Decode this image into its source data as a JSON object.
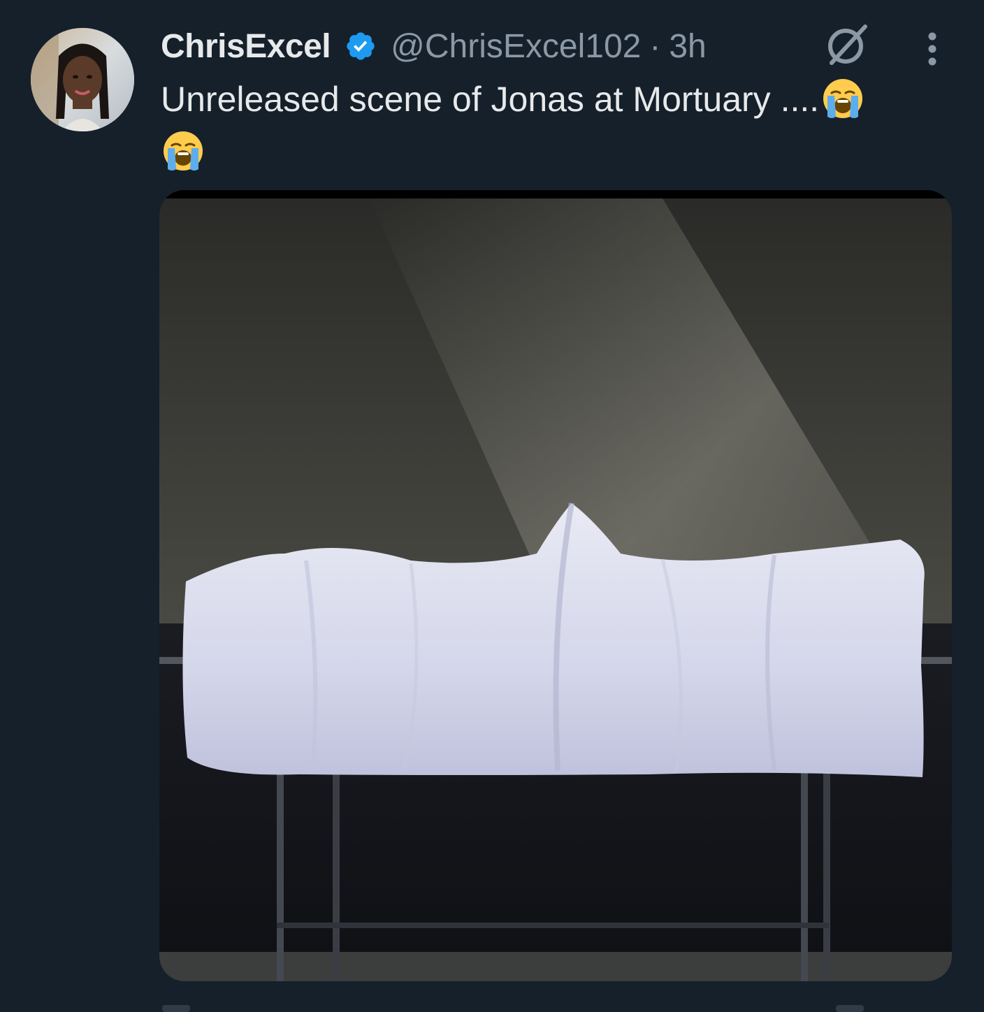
{
  "author": {
    "display_name": "ChrisExcel",
    "handle": "@ChrisExcel102",
    "separator": "·",
    "time": "3h",
    "verified": true,
    "avatar_icon": "profile-photo"
  },
  "tweet": {
    "text": "Unreleased scene of Jonas at Mortuary ....",
    "emojis": [
      "loudly-crying-face",
      "loudly-crying-face"
    ]
  },
  "media": {
    "type": "photo"
  },
  "icons": {
    "verified": "verified-badge-icon",
    "grok": "grok-icon",
    "more": "more-vertical-icon"
  },
  "colors": {
    "background": "#15202b",
    "primary_text": "#e7e9ea",
    "secondary_text": "#8b98a5",
    "verified_blue": "#1d9bf0"
  }
}
